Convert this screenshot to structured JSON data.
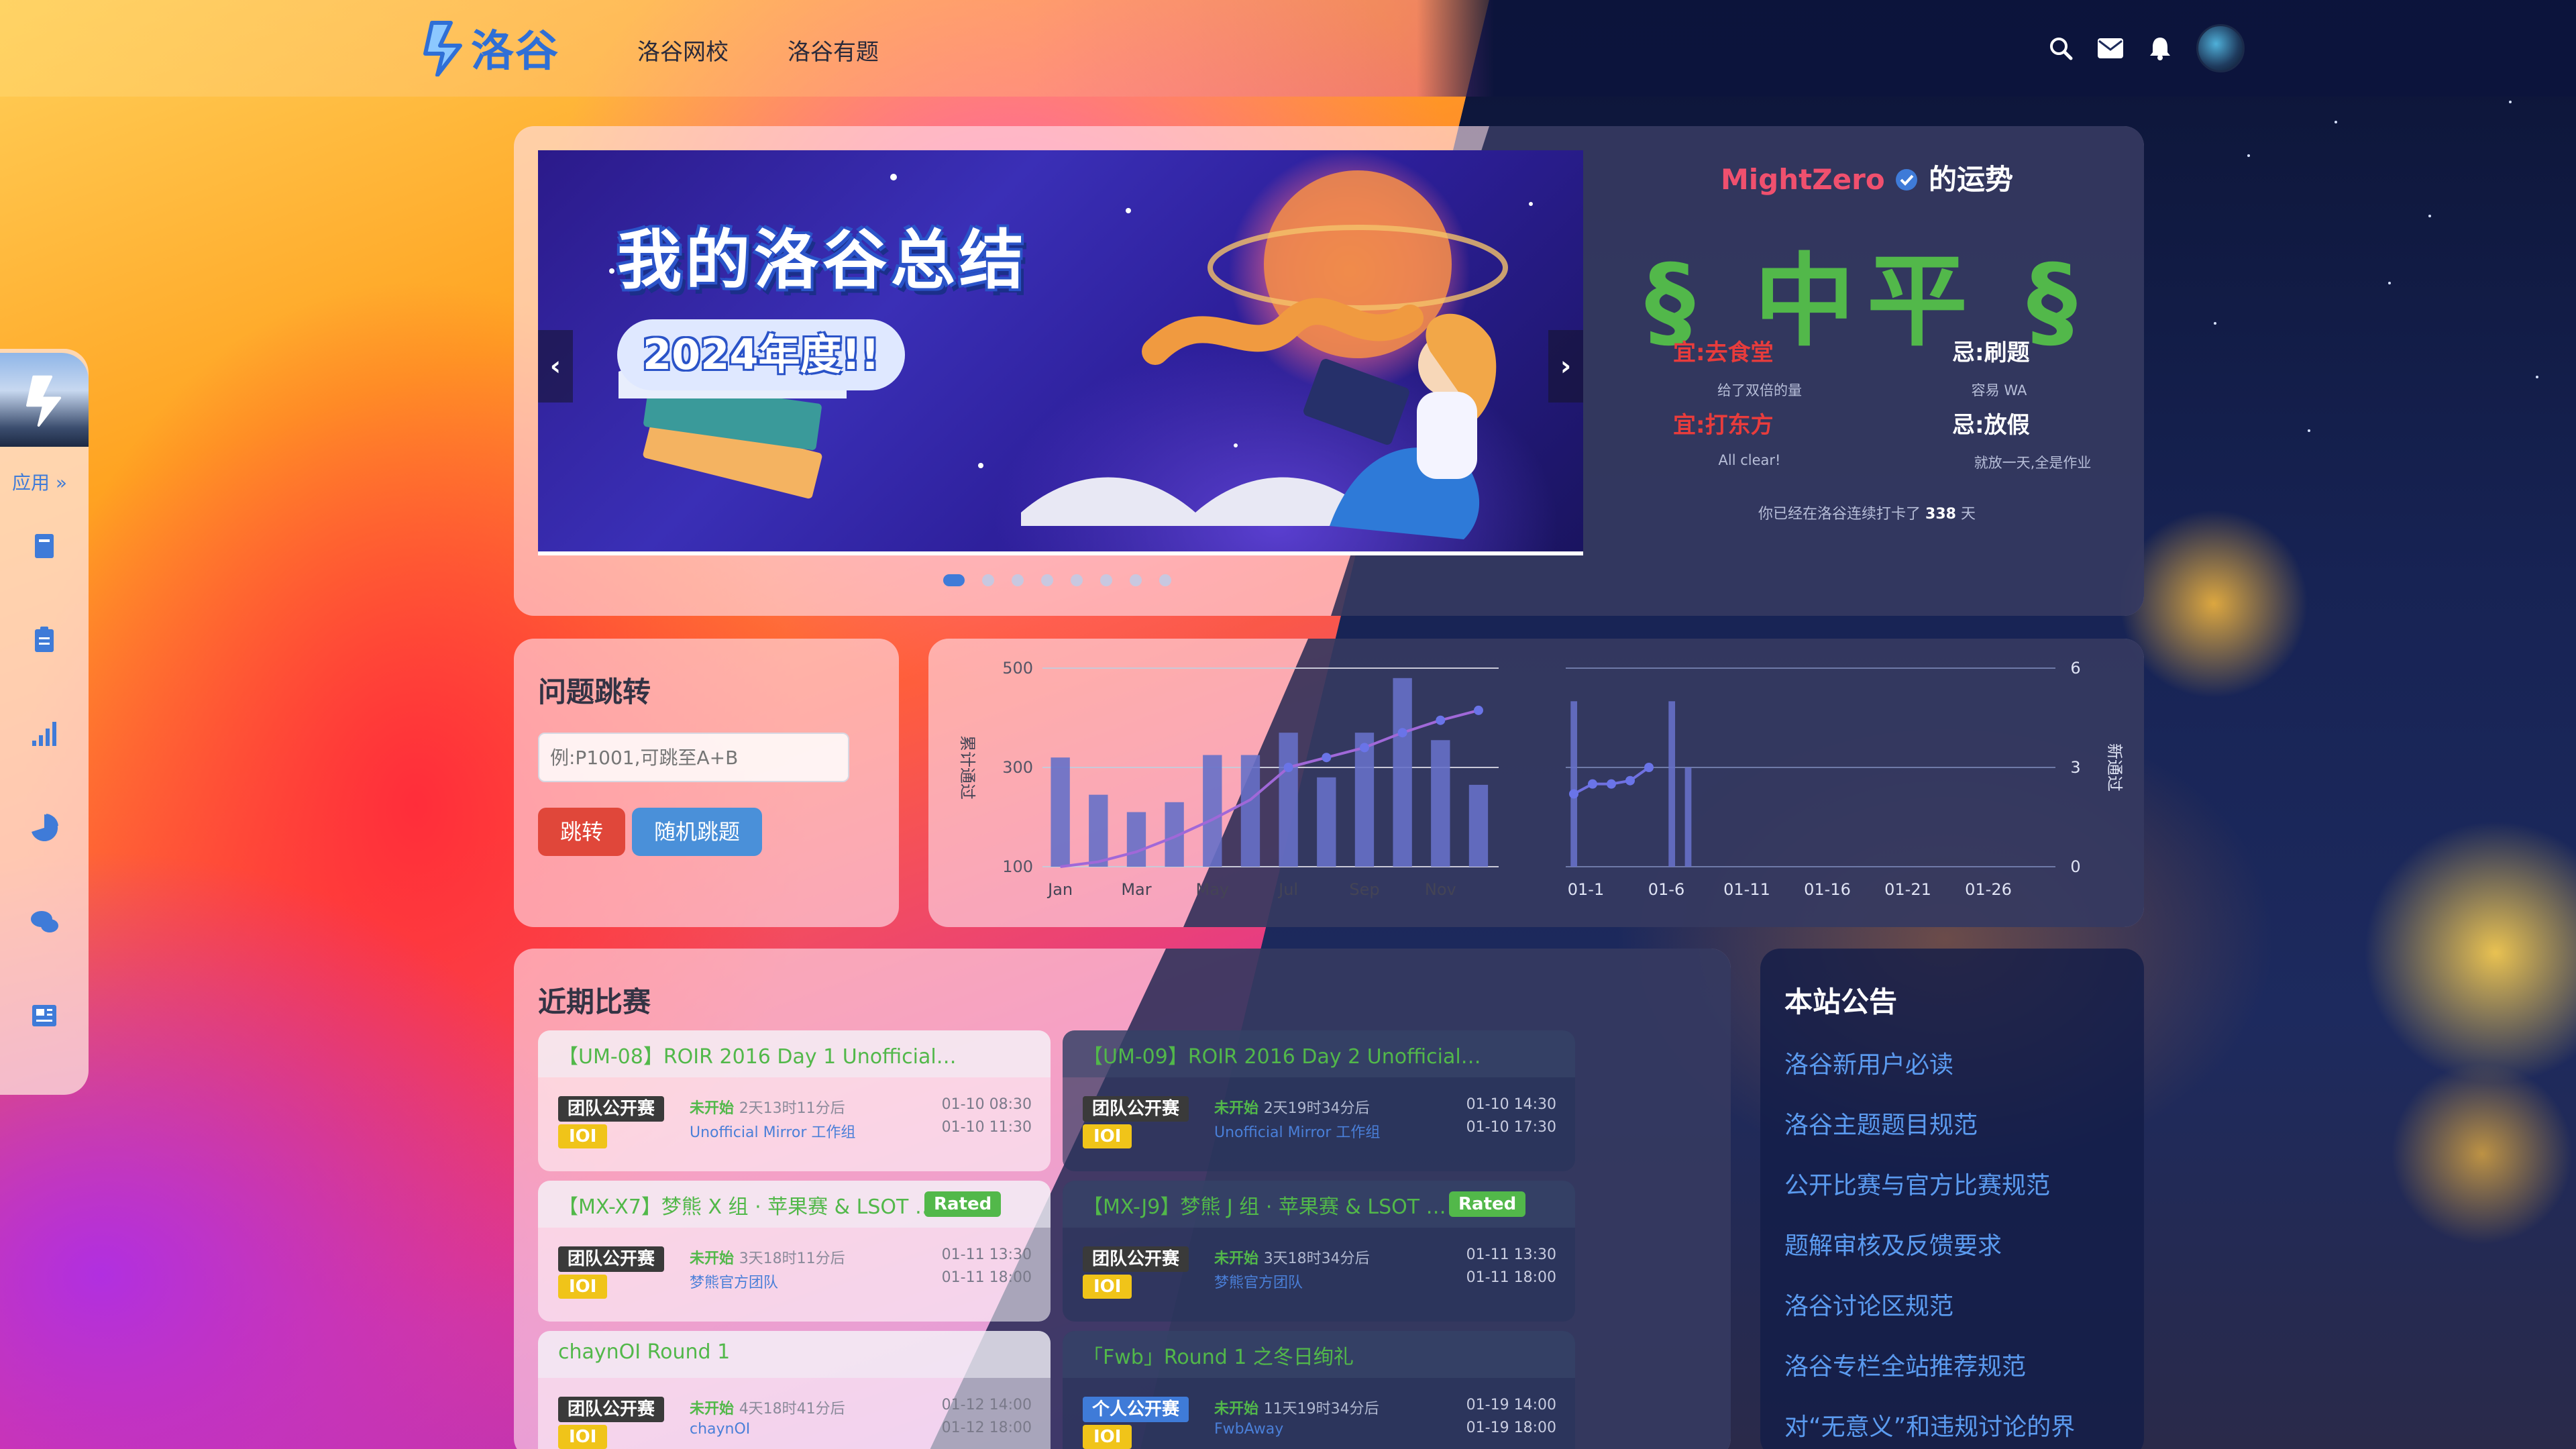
{
  "brand": {
    "name": "洛谷",
    "accent": "#3f7bd8"
  },
  "topnav": {
    "links": [
      "洛谷网校",
      "洛谷有题"
    ]
  },
  "sidebar": {
    "apps_label": "应用 »"
  },
  "banner": {
    "title": "我的洛谷总结",
    "subtitle": "2024年度!!",
    "dot_count": 8,
    "active_dot": 0
  },
  "fortune": {
    "user": "MightZero",
    "suffix": "的运势",
    "result": "§ 中平 §",
    "good": [
      {
        "label": "宜:",
        "item": "去食堂",
        "note": "给了双倍的量"
      },
      {
        "label": "宜:",
        "item": "打东方",
        "note": "All clear!"
      }
    ],
    "bad": [
      {
        "label": "忌:",
        "item": "刷题",
        "note": "容易 WA"
      },
      {
        "label": "忌:",
        "item": "放假",
        "note": "就放一天,全是作业"
      }
    ],
    "streak_prefix": "你已经在洛谷连续打卡了",
    "streak_days": "338",
    "streak_suffix": "天"
  },
  "jump": {
    "title": "问题跳转",
    "placeholder": "例:P1001,可跳至A+B",
    "jump_label": "跳转",
    "random_label": "随机跳题"
  },
  "chart_data": [
    {
      "type": "bar",
      "ylabel": "累计通过",
      "ylim": [
        100,
        500
      ],
      "yticks": [
        100,
        300,
        500
      ],
      "xticks": [
        "Jan",
        "Mar",
        "May",
        "Jul",
        "Sep",
        "Nov"
      ],
      "bars": [
        320,
        245,
        210,
        230,
        325,
        325,
        370,
        280,
        370,
        480,
        355,
        265
      ],
      "line": [
        100,
        110,
        130,
        160,
        195,
        235,
        300,
        320,
        340,
        370,
        395,
        415
      ],
      "colors": {
        "bar": "#6670c8",
        "line": "#a068d8"
      }
    },
    {
      "type": "bar",
      "ylabel": "新通过",
      "ylim": [
        0,
        6
      ],
      "yticks": [
        0,
        3,
        6
      ],
      "xticks": [
        "01-1",
        "01-6",
        "01-11",
        "01-16",
        "01-21",
        "01-26"
      ],
      "bars": [
        5,
        0,
        0,
        0,
        0,
        0,
        5,
        3,
        0,
        0,
        0,
        0,
        0,
        0,
        0,
        0,
        0,
        0,
        0,
        0,
        0,
        0,
        0,
        0,
        0,
        0,
        0,
        0,
        0,
        0
      ],
      "line": [
        2.2,
        2.5,
        2.5,
        2.6,
        3.0
      ],
      "colors": {
        "bar": "#6670c8",
        "line": "#7070e0"
      }
    }
  ],
  "contests": {
    "title": "近期比赛",
    "items": [
      {
        "name": "【UM-08】ROIR 2016 Day 1 Unofficial…",
        "rated": "",
        "type": "团队公开赛",
        "rule": "IOI",
        "status": "未开始",
        "countdown": "2天13时11分后",
        "host": "Unofficial Mirror 工作组",
        "start": "01-10 08:30",
        "end": "01-10 11:30"
      },
      {
        "name": "【UM-09】ROIR 2016 Day 2 Unofficial…",
        "rated": "",
        "type": "团队公开赛",
        "rule": "IOI",
        "status": "未开始",
        "countdown": "2天19时34分后",
        "host": "Unofficial Mirror 工作组",
        "start": "01-10 14:30",
        "end": "01-10 17:30"
      },
      {
        "name": "【MX-X7】梦熊 X 组 · 苹果赛 & LSOT …",
        "rated": "Rated",
        "type": "团队公开赛",
        "rule": "IOI",
        "status": "未开始",
        "countdown": "3天18时11分后",
        "host": "梦熊官方团队",
        "start": "01-11 13:30",
        "end": "01-11 18:00"
      },
      {
        "name": "【MX-J9】梦熊 J 组 · 苹果赛 & LSOT …",
        "rated": "Rated",
        "type": "团队公开赛",
        "rule": "IOI",
        "status": "未开始",
        "countdown": "3天18时34分后",
        "host": "梦熊官方团队",
        "start": "01-11 13:30",
        "end": "01-11 18:00"
      },
      {
        "name": "chaynOI Round 1",
        "rated": "",
        "type": "团队公开赛",
        "rule": "IOI",
        "status": "未开始",
        "countdown": "4天18时41分后",
        "host": "chaynOI",
        "start": "01-12 14:00",
        "end": "01-12 18:00"
      },
      {
        "name": "「Fwb」Round 1 之冬日绚礼",
        "rated": "",
        "type": "个人公开赛",
        "rule": "IOI",
        "status": "未开始",
        "countdown": "11天19时34分后",
        "host": "FwbAway",
        "start": "01-19 14:00",
        "end": "01-19 18:00"
      }
    ]
  },
  "notices": {
    "title": "本站公告",
    "items": [
      "洛谷新用户必读",
      "洛谷主题题目规范",
      "公开比赛与官方比赛规范",
      "题解审核及反馈要求",
      "洛谷讨论区规范",
      "洛谷专栏全站推荐规范",
      "对“无意义”和违规讨论的界"
    ]
  }
}
